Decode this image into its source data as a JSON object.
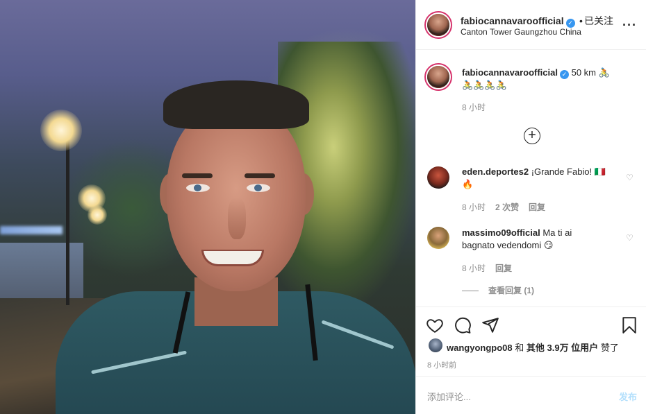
{
  "post": {
    "username": "fabiocannavaroofficial",
    "follow_status": "已关注",
    "separator": "•",
    "location": "Canton Tower Gaungzhou China",
    "more_icon": "more-horizontal-icon"
  },
  "caption": {
    "username": "fabiocannavaroofficial",
    "text": "50 km 🚴",
    "text_line2": "🚴🚴🚴🚴",
    "time": "8 小时"
  },
  "load_more_icon": "plus-circle-icon",
  "comments": [
    {
      "username": "eden.deportes2",
      "text": "¡Grande Fabio! 🇮🇹",
      "text_line2": "🔥",
      "time": "8 小时",
      "likes": "2 次赞",
      "reply": "回复"
    },
    {
      "username": "massimo09official",
      "text": "Ma ti ai",
      "text_line2": "bagnato vedendomi 😏",
      "time": "8 小时",
      "reply": "回复",
      "view_replies": "查看回复 (1)"
    }
  ],
  "actions": {
    "like_icon": "heart-icon",
    "comment_icon": "comment-icon",
    "share_icon": "send-icon",
    "save_icon": "bookmark-icon"
  },
  "likes": {
    "liker": "wangyongpo08",
    "and": "和",
    "others": "其他 3.9万 位用户",
    "liked": "赞了",
    "time": "8 小时前"
  },
  "add_comment": {
    "placeholder": "添加评论...",
    "post_label": "发布"
  },
  "colors": {
    "verified": "#3897f0",
    "post_button_disabled": "#b2dffc",
    "muted_text": "#8e8e8e",
    "primary_text": "#262626"
  }
}
